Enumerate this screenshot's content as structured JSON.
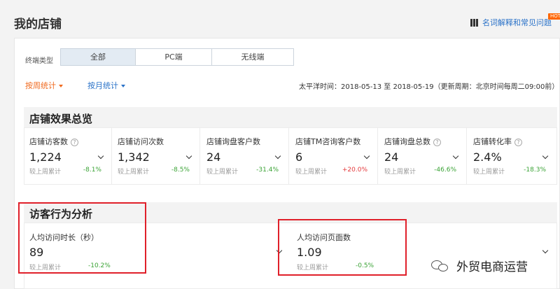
{
  "header": {
    "title": "我的店铺",
    "help_link": "名词解释和常见问题",
    "hot_badge": "HOT"
  },
  "filters": {
    "terminal_label": "终端类型",
    "segments": [
      "全部",
      "PC端",
      "无线端"
    ],
    "active_segment": "全部",
    "weekly_label": "按周统计",
    "monthly_label": "按月统计",
    "date_info": "太平洋时间：2018-05-13 至 2018-05-19（更新周期：北京时间每周二09:00前）"
  },
  "overview": {
    "title": "店铺效果总览",
    "cards": [
      {
        "label": "店铺访客数",
        "has_help": true,
        "value": "1,224",
        "compare_label": "较上周累计",
        "change": "-8.1%",
        "direction": "down"
      },
      {
        "label": "店铺访问次数",
        "has_help": false,
        "value": "1,342",
        "compare_label": "较上周累计",
        "change": "-8.5%",
        "direction": "down"
      },
      {
        "label": "店铺询盘客户数",
        "has_help": false,
        "value": "24",
        "compare_label": "较上周累计",
        "change": "-31.4%",
        "direction": "down"
      },
      {
        "label": "店铺TM咨询客户数",
        "has_help": false,
        "value": "6",
        "compare_label": "较上周累计",
        "change": "+20.0%",
        "direction": "up"
      },
      {
        "label": "店铺询盘总数",
        "has_help": true,
        "value": "24",
        "compare_label": "较上周累计",
        "change": "-46.6%",
        "direction": "down"
      },
      {
        "label": "店铺转化率",
        "has_help": true,
        "value": "2.4%",
        "compare_label": "较上周累计",
        "change": "-18.3%",
        "direction": "down"
      }
    ]
  },
  "visitor": {
    "title": "访客行为分析",
    "cards": [
      {
        "label": "人均访问时长（秒）",
        "value": "89",
        "compare_label": "较上周累计",
        "change": "-10.2%",
        "direction": "down"
      },
      {
        "label": "人均访问页面数",
        "value": "1.09",
        "compare_label": "较上周累计",
        "change": "-0.5%",
        "direction": "down"
      }
    ]
  },
  "watermark": {
    "text": "外贸电商运营"
  },
  "colors": {
    "accent_orange": "#f06a1f",
    "link_blue": "#2a72c8",
    "down_green": "#3aa335",
    "up_red": "#e4393c",
    "highlight_red": "#e0202a"
  }
}
